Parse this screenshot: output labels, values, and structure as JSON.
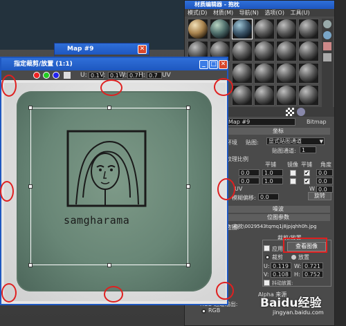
{
  "material_editor": {
    "title": "材质编辑器 - 抱枕",
    "menu": [
      "模式(D)",
      "材质(M)",
      "导航(N)",
      "选项(O)",
      "工具(U)"
    ]
  },
  "map_window": {
    "title": "Map #9"
  },
  "crop_window": {
    "title": "指定裁剪/放置 (1:1)",
    "toolbar": {
      "u_label": "U:",
      "u_value": "0.1",
      "v_label": "V:",
      "v_value": "0.1",
      "w_label": "W:",
      "w_value": "0.7",
      "h_label": "H:",
      "h_value": "0.7",
      "uv_label": "UV"
    },
    "pillow_text": "samgharama"
  },
  "params": {
    "map_name": "Map #9",
    "map_type": "Bitmap",
    "coords_header": "坐标",
    "env_label": "环境",
    "mapping_label": "贴图:",
    "mapping_value": "显式贴图通道",
    "map_channel_label": "贴图通道:",
    "map_channel_value": "1",
    "scale_label": "纹理比例",
    "tiling_header": "平铺",
    "mirror_header": "镜像",
    "tile_header": "平铺",
    "angle_header": "角度",
    "offset_values": [
      "0.0",
      "0.0"
    ],
    "tiling_values": [
      "1.0",
      "1.0"
    ],
    "angle_values": [
      "0.0",
      "0.0",
      "0.0"
    ],
    "w_label": "W",
    "uv_label": "UV",
    "blur_offset_label": "模糊偏移:",
    "blur_offset_value": "0.0",
    "rotate_label": "旋转",
    "noise_header": "噪波",
    "bitmap_params_header": "位图参数",
    "bitmap_label": "位图:",
    "bitmap_path": "D:\\抱枕\\0029543tqmq1j8jpjqhh0h.jpg",
    "crop_header": "裁剪/放置",
    "apply_label": "应用",
    "view_image_label": "查看图像",
    "crop_label": "裁剪",
    "place_label": "放置",
    "u_value": "0.119",
    "v_value": "0.108",
    "w_value": "0.721",
    "h_value": "0.752",
    "jitter_label": "抖动放置:",
    "alpha_source_label": "Alpha 来源",
    "rgb_output_label": "RGB 通道输出:",
    "rgb_label": "RGB"
  },
  "watermark": {
    "text": "Baidu经验",
    "url": "jingyan.baidu.com"
  }
}
